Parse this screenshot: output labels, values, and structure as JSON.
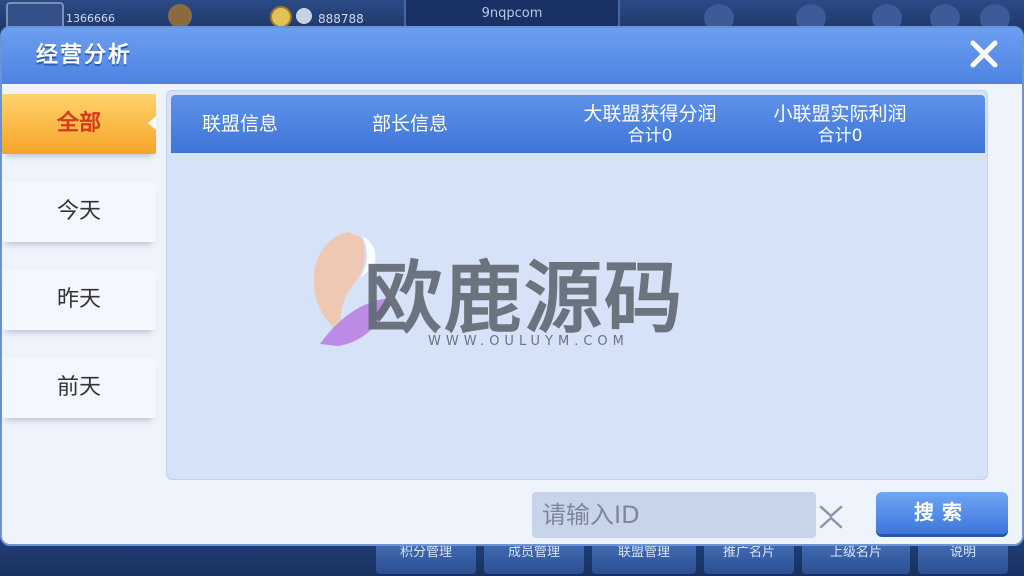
{
  "background": {
    "user_id": "1366666",
    "gold_amount": "888788",
    "site_label": "9nqpcom",
    "bottom_buttons": [
      "积分管理",
      "成员管理",
      "联盟管理",
      "推广名片",
      "上级名片",
      "说明"
    ]
  },
  "modal": {
    "title": "经营分析",
    "close_icon": "close-icon"
  },
  "tabs": [
    {
      "label": "全部",
      "active": true
    },
    {
      "label": "今天",
      "active": false
    },
    {
      "label": "昨天",
      "active": false
    },
    {
      "label": "前天",
      "active": false
    }
  ],
  "table": {
    "columns": [
      {
        "label": "联盟信息"
      },
      {
        "label": "部长信息"
      },
      {
        "label": "大联盟获得分润",
        "sub": "合计0"
      },
      {
        "label": "小联盟实际利润",
        "sub": "合计0"
      }
    ],
    "rows": []
  },
  "watermark": {
    "text": "欧鹿源码",
    "url": "WWW.OULUYM.COM"
  },
  "search": {
    "placeholder": "请输入ID",
    "value": "",
    "button_label": "搜索"
  },
  "colors": {
    "header_blue": "#4d82e2",
    "tab_active": "#f6a42a",
    "tab_active_text": "#d63a1d"
  }
}
